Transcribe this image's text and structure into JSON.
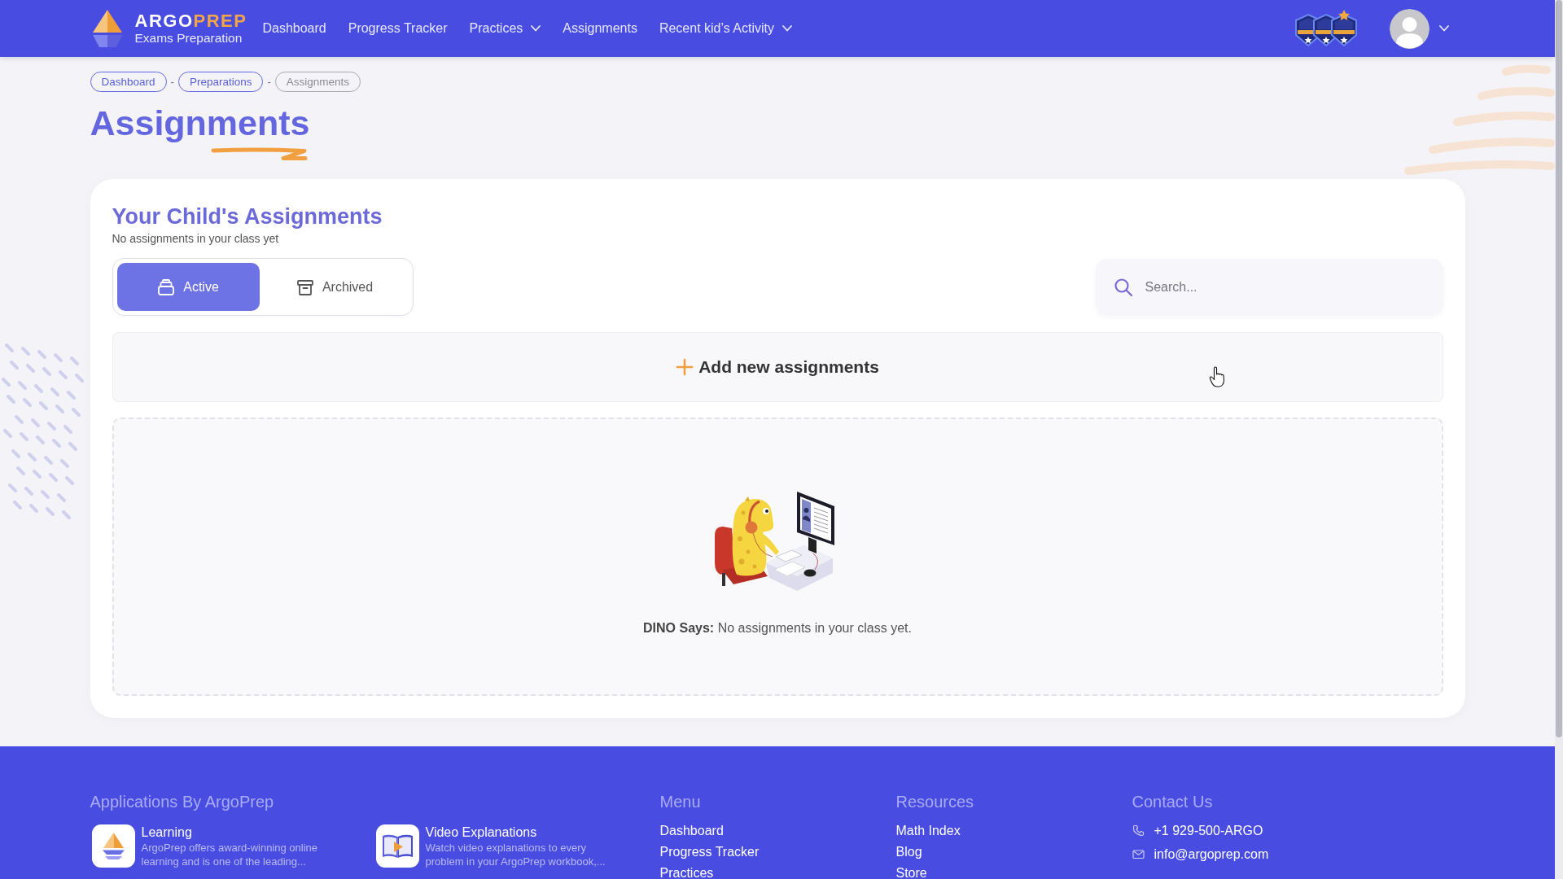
{
  "header": {
    "logo": {
      "brand_main": "ARGO",
      "brand_accent": "PREP",
      "tagline": "Exams Preparation"
    },
    "nav": [
      {
        "label": "Dashboard",
        "dropdown": false
      },
      {
        "label": "Progress Tracker",
        "dropdown": false
      },
      {
        "label": "Practices",
        "dropdown": true
      },
      {
        "label": "Assignments",
        "dropdown": false
      },
      {
        "label": "Recent kid’s Activity",
        "dropdown": true
      }
    ]
  },
  "breadcrumbs": {
    "separator": "-",
    "items": [
      {
        "label": "Dashboard",
        "current": false
      },
      {
        "label": "Preparations",
        "current": false
      },
      {
        "label": "Assignments",
        "current": true
      }
    ]
  },
  "page_title": "Assignments",
  "card": {
    "title": "Your Child's Assignments",
    "subtitle": "No assignments in your class yet",
    "tabs": [
      {
        "label": "Active",
        "selected": true
      },
      {
        "label": "Archived",
        "selected": false
      }
    ],
    "search": {
      "placeholder": "Search..."
    },
    "add_button": "Add new assignments",
    "empty_state": "**DINO Says:** No assignments in your class yet."
  },
  "footer": {
    "applications": {
      "heading": "Applications By ArgoPrep",
      "apps": [
        {
          "name": "Learning",
          "description": "ArgoPrep offers award-winning online learning and is one of the leading..."
        },
        {
          "name": "Video Explanations",
          "description": "Watch video explanations to every problem in your ArgoPrep workbook,..."
        }
      ]
    },
    "menu": {
      "heading": "Menu",
      "links": [
        "Dashboard",
        "Progress Tracker",
        "Practices"
      ]
    },
    "resources": {
      "heading": "Resources",
      "links": [
        "Math Index",
        "Blog",
        "Store"
      ]
    },
    "contact": {
      "heading": "Contact Us",
      "items": [
        {
          "kind": "phone",
          "text": "+1 929-500-ARGO"
        },
        {
          "kind": "email",
          "text": "info@argoprep.com"
        }
      ]
    }
  }
}
